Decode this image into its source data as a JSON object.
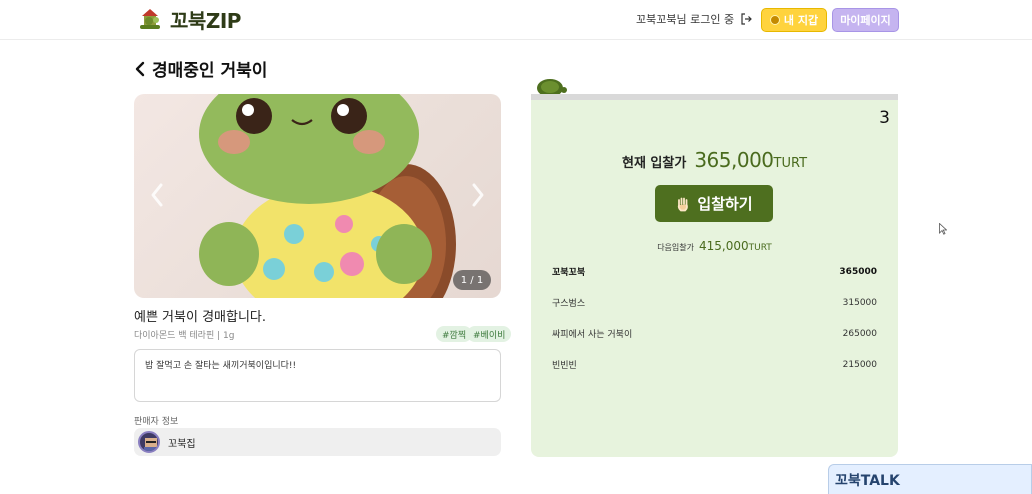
{
  "header": {
    "logo_text_main": "꼬북",
    "logo_text_zip": "ZIP",
    "login_status": "꼬북꼬북님 로그인 중",
    "wallet_label": "내 지갑",
    "mypage_label": "마이페이지"
  },
  "page": {
    "title": "경매중인 거북이"
  },
  "carousel": {
    "counter": "1 / 1"
  },
  "item": {
    "title": "예쁜 거북이 경매합니다.",
    "meta": "다이아몬드 백 테라핀 | 1g",
    "tags": [
      "#깜찍",
      "#베이비"
    ],
    "description": "밥 잘먹고 손 잘타는 새끼거북이입니다!!"
  },
  "seller": {
    "label": "판매자 정보",
    "name": "꼬북집"
  },
  "auction": {
    "bid_count": "3",
    "current_label": "현재 입찰가",
    "current_value": "365,000",
    "current_unit": "TURT",
    "bid_button": "입찰하기",
    "next_label": "다음입찰가",
    "next_value": "415,000",
    "next_unit": "TURT",
    "bids": [
      {
        "name": "꼬북꼬북",
        "amount": "365000"
      },
      {
        "name": "구스범스",
        "amount": "315000"
      },
      {
        "name": "싸피에서 사는 거북이",
        "amount": "265000"
      },
      {
        "name": "빈빈빈",
        "amount": "215000"
      }
    ]
  },
  "chat": {
    "label": "꼬북TALK"
  },
  "colors": {
    "brand_green": "#4e6f1f",
    "panel_bg": "#e7f3dd",
    "wallet_yellow": "#ffd33d",
    "mypage_purple": "#c5b4f0"
  }
}
